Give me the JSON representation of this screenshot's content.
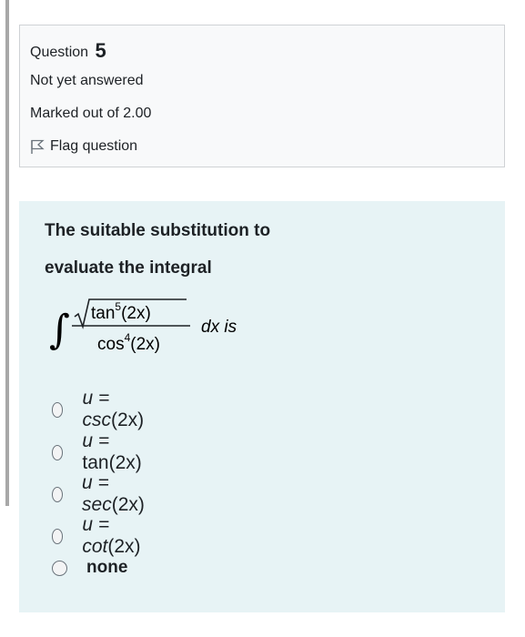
{
  "question": {
    "label": "Question",
    "number": "5",
    "state": "Not yet answered",
    "grade": "Marked out of 2.00",
    "flag_label": "Flag question"
  },
  "text": {
    "line1": "The suitable substitution to",
    "line2": "evaluate the integral",
    "integral": {
      "numerator": "tan",
      "num_exp": "5",
      "num_arg": "(2x)",
      "denominator": "cos",
      "den_exp": "4",
      "den_arg": "(2x)",
      "suffix": "dx is"
    }
  },
  "options": [
    {
      "prefix": "u =",
      "fn": "csc",
      "arg": "(2x)"
    },
    {
      "prefix": "u =",
      "fn": "tan",
      "arg": "(2x)"
    },
    {
      "prefix": "u =",
      "fn": "sec",
      "arg": "(2x)"
    },
    {
      "prefix": "u =",
      "fn": "cot",
      "arg": "(2x)"
    },
    {
      "label": "none"
    }
  ]
}
